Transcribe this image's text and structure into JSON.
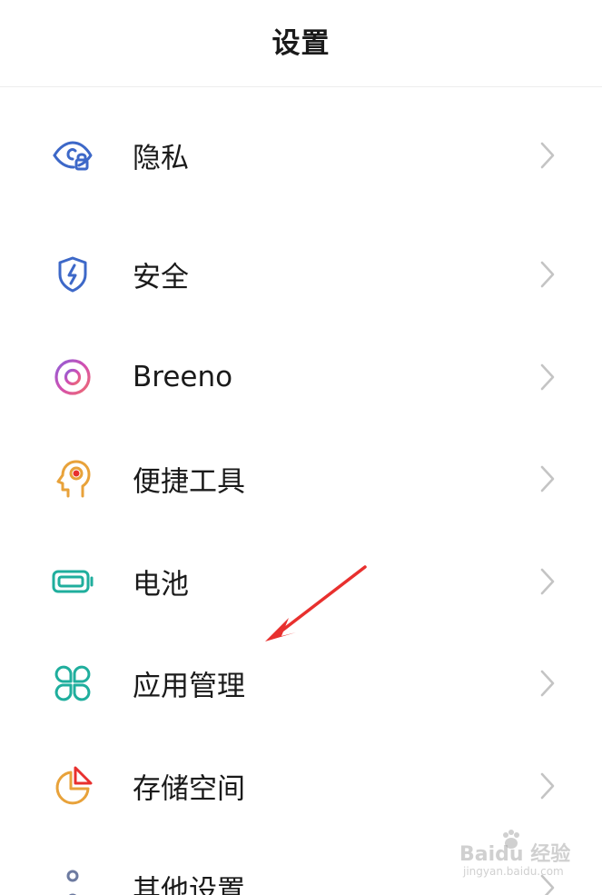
{
  "header": {
    "title": "设置"
  },
  "settings": {
    "items": [
      {
        "label": "隐私",
        "icon": "privacy-eye-lock-icon",
        "color": "#3d68c8"
      },
      {
        "label": "安全",
        "icon": "security-shield-icon",
        "color": "#3d68c8"
      },
      {
        "label": "Breeno",
        "icon": "breeno-ring-icon",
        "color": "#b44fc9"
      },
      {
        "label": "便捷工具",
        "icon": "convenience-head-icon",
        "color": "#e8a23a"
      },
      {
        "label": "电池",
        "icon": "battery-icon",
        "color": "#1fae9d"
      },
      {
        "label": "应用管理",
        "icon": "app-management-icon",
        "color": "#1fae9d"
      },
      {
        "label": "存储空间",
        "icon": "storage-pie-icon",
        "color": "#e8a23a"
      },
      {
        "label": "其他设置",
        "icon": "other-settings-dots-icon",
        "color": "#6c7aa0"
      }
    ]
  },
  "annotation": {
    "arrow_color": "#e8302e"
  },
  "watermark": {
    "main": "Baidu 经验",
    "sub": "jingyan.baidu.com"
  }
}
